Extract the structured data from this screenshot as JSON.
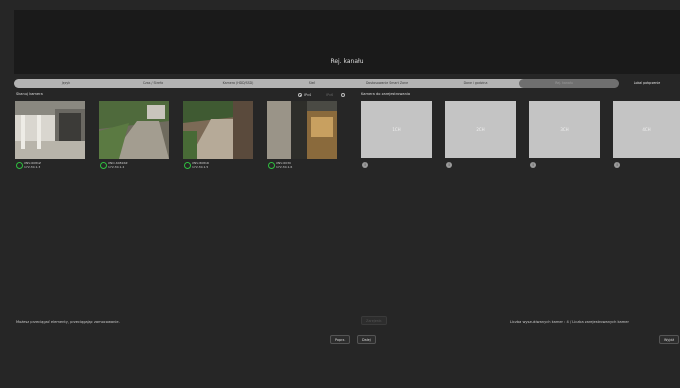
{
  "window": {
    "title": "Rej. kanału"
  },
  "tabs": [
    "Język",
    "Czas / Strefa",
    "Kamera (HDD/SSD)",
    "Sieć",
    "Dostosowanie Smart Zone",
    "Dane i godzina",
    "Rej. kanału",
    "Lokal połączenie"
  ],
  "scanned": {
    "label": "Skanuj kamera",
    "protocol_options": [
      {
        "label": "IPv4",
        "selected": true
      },
      {
        "label": "IPv6",
        "selected": false
      }
    ],
    "cameras": [
      {
        "model": "XNV-6081Z",
        "ip": "172.30.1.3"
      },
      {
        "model": "XNO-6081RZ",
        "ip": "172.30.1.4"
      },
      {
        "model": "XNV-8081R",
        "ip": "172.30.1.5"
      },
      {
        "model": "XNV-6030",
        "ip": "172.30.1.6"
      }
    ]
  },
  "registration": {
    "label": "Kamera do zarejestrowania",
    "slots": [
      "1CH",
      "2CH",
      "3CH",
      "4CH"
    ]
  },
  "footer": {
    "hint": "Możesz przeciągać elementy, przeciągając zamocowanie.",
    "register_button": "Zarejestr.",
    "status": "Liczba wyszukiwanych kamer : 4 / Liczba zarejestrowanych kamer",
    "back_button": "Poprz.",
    "next_button": "Dalej",
    "exit_button": "Wyjdź"
  }
}
